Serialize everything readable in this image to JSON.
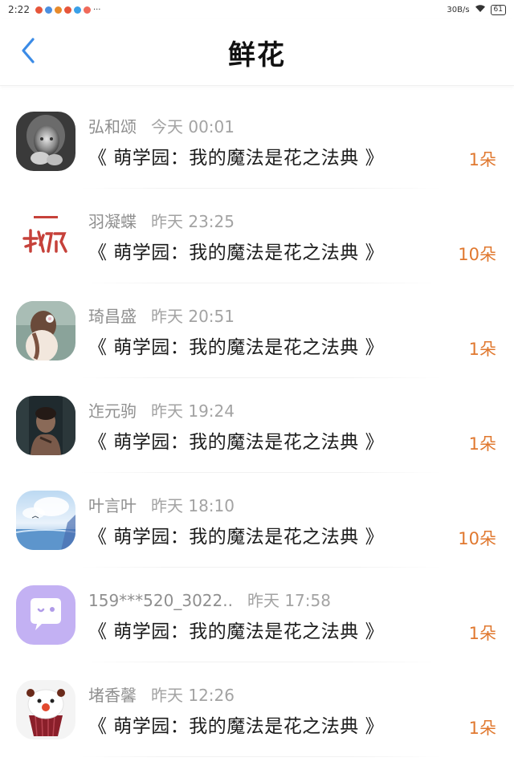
{
  "status_bar": {
    "time": "2:22",
    "more": "···",
    "network_speed": "30B/s",
    "battery": "61"
  },
  "header": {
    "title": "鲜花"
  },
  "items": [
    {
      "username": "弘和颂",
      "time": "今天 00:01",
      "book_title": "《 萌学园：我的魔法是花之法典 》",
      "amount": "1朵",
      "avatar": "child-portrait"
    },
    {
      "username": "羽凝蝶",
      "time": "昨天 23:25",
      "book_title": "《 萌学园：我的魔法是花之法典 》",
      "amount": "10朵",
      "avatar": "red-calligraphy"
    },
    {
      "username": "琦昌盛",
      "time": "昨天 20:51",
      "book_title": "《 萌学园：我的魔法是花之法典 》",
      "amount": "1朵",
      "avatar": "girl-with-flower"
    },
    {
      "username": "迮元驹",
      "time": "昨天 19:24",
      "book_title": "《 萌学园：我的魔法是花之法典 》",
      "amount": "1朵",
      "avatar": "dark-portrait"
    },
    {
      "username": "叶言叶",
      "time": "昨天 18:10",
      "book_title": "《 萌学园：我的魔法是花之法典 》",
      "amount": "10朵",
      "avatar": "sky-sea"
    },
    {
      "username": "159***520_3022..",
      "time": "昨天 17:58",
      "book_title": "《 萌学园：我的魔法是花之法典 》",
      "amount": "1朵",
      "avatar": "default-chat-bubble"
    },
    {
      "username": "堵香馨",
      "time": "昨天 12:26",
      "book_title": "《 萌学园：我的魔法是花之法典 》",
      "amount": "1朵",
      "avatar": "snowman-cupcake"
    }
  ],
  "colors": {
    "accent_blue": "#3b8be6",
    "amount_orange": "#e0782f"
  }
}
